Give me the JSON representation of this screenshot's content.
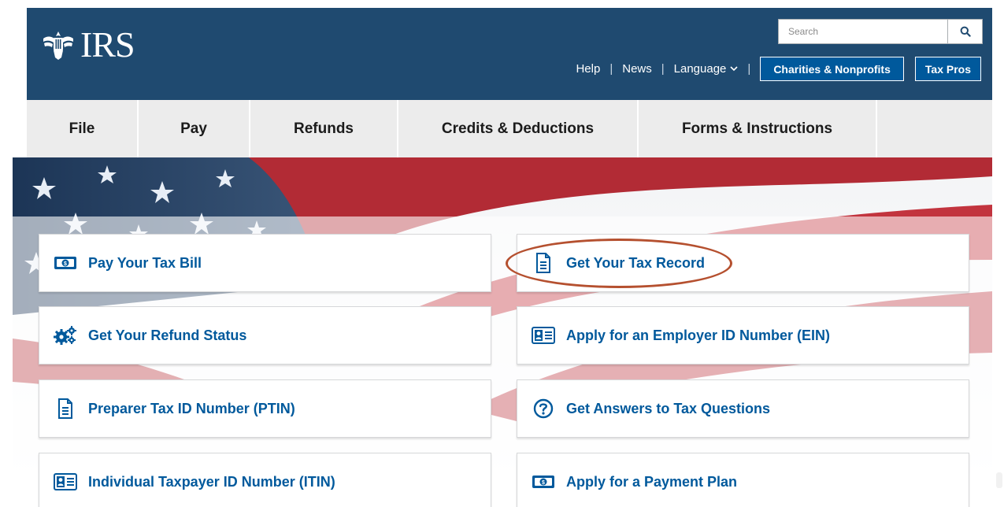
{
  "brand": {
    "wordmark": "IRS",
    "logo_icon": "eagle-seal-icon"
  },
  "search": {
    "placeholder": "Search",
    "icon": "search-icon"
  },
  "utility_nav": {
    "help": "Help",
    "news": "News",
    "language": "Language",
    "separator": "|",
    "charities_button": "Charities & Nonprofits",
    "tax_pros_button": "Tax Pros"
  },
  "main_nav": [
    {
      "label": "File"
    },
    {
      "label": "Pay"
    },
    {
      "label": "Refunds"
    },
    {
      "label": "Credits & Deductions"
    },
    {
      "label": "Forms & Instructions"
    }
  ],
  "cards": [
    {
      "label": "Pay Your Tax Bill",
      "icon": "money-bill-icon"
    },
    {
      "label": "Get Your Tax Record",
      "icon": "document-icon",
      "highlighted": true
    },
    {
      "label": "Get Your Refund Status",
      "icon": "gears-icon"
    },
    {
      "label": "Apply for an Employer ID Number (EIN)",
      "icon": "id-card-icon"
    },
    {
      "label": "Preparer Tax ID Number (PTIN)",
      "icon": "document-icon"
    },
    {
      "label": "Get Answers to Tax Questions",
      "icon": "question-circle-icon"
    },
    {
      "label": "Individual Taxpayer ID Number (ITIN)",
      "icon": "id-card-icon"
    },
    {
      "label": "Apply for a Payment Plan",
      "icon": "money-bill-icon"
    }
  ],
  "colors": {
    "header_bg": "#1f4a70",
    "button_bg": "#00599c",
    "link": "#00599c",
    "nav_bg": "#ececec",
    "highlight_ring": "#b5502f"
  }
}
